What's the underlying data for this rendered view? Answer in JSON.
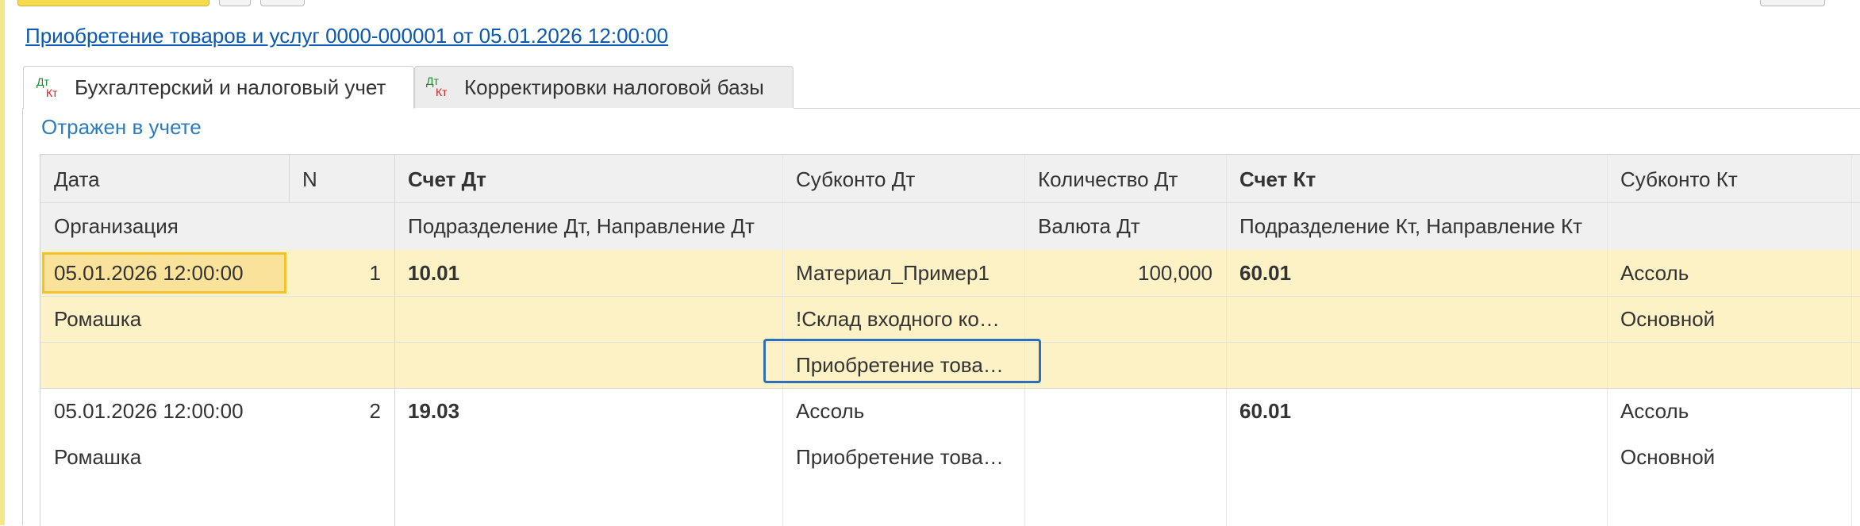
{
  "document_link": "Приобретение товаров и услуг 0000-000001 от 05.01.2026 12:00:00",
  "tabs": [
    {
      "icon": "dt-kt-icon",
      "icon_dt": "Дт",
      "icon_kt": "Кт",
      "label": "Бухгалтерский и налоговый учет"
    },
    {
      "icon": "dt-kt-icon",
      "icon_dt": "Дт",
      "icon_kt": "Кт",
      "label": "Корректировки налоговой базы"
    }
  ],
  "status": "Отражен в учете",
  "colors": {
    "accent_link": "#0b59b3",
    "status_text": "#2e7bbf",
    "selected_row": "#fdf1c6",
    "current_cell": "#fae29b",
    "focus_border": "#2f6fb5"
  },
  "table": {
    "headers_row1": {
      "date": "Дата",
      "n": "N",
      "account_dt": "Счет Дт",
      "subconto_dt": "Субконто Дт",
      "quantity_dt": "Количество Дт",
      "account_kt": "Счет Кт",
      "subconto_kt": "Субконто Кт"
    },
    "headers_row2": {
      "organization": "Организация",
      "division_dt": "Подразделение Дт, Направление Дт",
      "currency_dt": "Валюта Дт",
      "division_kt": "Подразделение Кт, Направление Кт"
    },
    "rows": [
      {
        "date": "05.01.2026 12:00:00",
        "n": "1",
        "account_dt": "10.01",
        "subconto_dt": [
          "Материал_Пример1",
          "!Склад входного ко…",
          "Приобретение това…"
        ],
        "quantity_dt": "100,000",
        "account_kt": "60.01",
        "subconto_kt": [
          "Ассоль",
          "Основной"
        ],
        "organization": "Ромашка"
      },
      {
        "date": "05.01.2026 12:00:00",
        "n": "2",
        "account_dt": "19.03",
        "subconto_dt": [
          "Ассоль",
          "Приобретение това…"
        ],
        "quantity_dt": "",
        "account_kt": "60.01",
        "subconto_kt": [
          "Ассоль",
          "Основной"
        ],
        "organization": "Ромашка"
      }
    ]
  }
}
